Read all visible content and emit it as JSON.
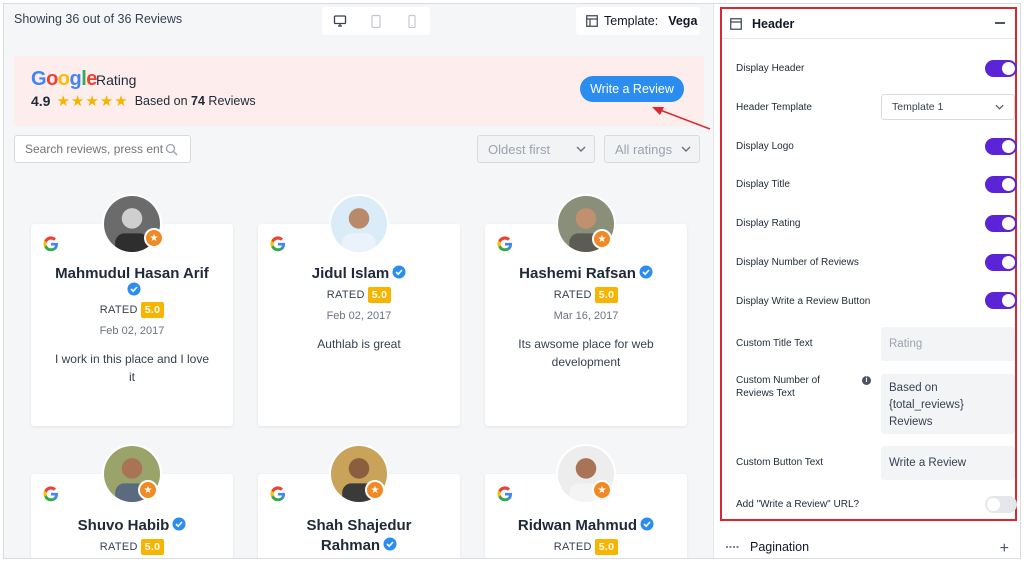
{
  "preview": {
    "showing_text": "Showing 36 out of 36 Reviews",
    "template_label": "Template:",
    "template_value": "Vega",
    "header": {
      "logo_letters": [
        "G",
        "o",
        "o",
        "g",
        "l",
        "e"
      ],
      "title": "Rating",
      "rating": "4.9",
      "stars": "★★★★★",
      "based_on_prefix": "Based on",
      "count": "74",
      "based_on_suffix": "Reviews",
      "button_label": "Write a Review"
    },
    "search_placeholder": "Search reviews, press ent",
    "sort_value": "Oldest first",
    "ratings_value": "All ratings",
    "rated_label": "RATED",
    "cards": [
      {
        "name": "Mahmudul Hasan Arif",
        "score": "5.0",
        "date": "Feb 02, 2017",
        "text": "I work in this place and I love it"
      },
      {
        "name": "Jidul Islam",
        "score": "5.0",
        "date": "Feb 02, 2017",
        "text": "Authlab is great"
      },
      {
        "name": "Hashemi Rafsan",
        "score": "5.0",
        "date": "Mar 16, 2017",
        "text": "Its awsome place for web development"
      },
      {
        "name": "Shuvo Habib",
        "score": "5.0",
        "date": "",
        "text": ""
      },
      {
        "name": "Shah Shajedur Rahman",
        "score": "5.0",
        "date": "",
        "text": ""
      },
      {
        "name": "Ridwan Mahmud",
        "score": "5.0",
        "date": "",
        "text": ""
      }
    ]
  },
  "settings": {
    "section_title": "Header",
    "rows": {
      "display_header": "Display Header",
      "header_template": "Header Template",
      "header_template_value": "Template 1",
      "display_logo": "Display Logo",
      "display_title": "Display Title",
      "display_rating": "Display Rating",
      "display_number": "Display Number of Reviews",
      "display_write": "Display Write a Review Button",
      "custom_title": "Custom Title Text",
      "custom_title_placeholder": "Rating",
      "custom_number_line1": "Custom Number of",
      "custom_number_line2": "Reviews Text",
      "custom_number_value_1": "Based on",
      "custom_number_value_2": "{total_reviews}",
      "custom_number_value_3": "Reviews",
      "custom_button": "Custom Button Text",
      "custom_button_value": "Write a Review",
      "add_url": "Add \"Write a Review\" URL?"
    },
    "pagination_title": "Pagination"
  },
  "colors": {
    "toggle_on": "#5b24d6",
    "button_blue": "#2b8df0",
    "score_badge": "#f7b500",
    "highlight_border": "#d9282f",
    "banner_bg": "#fdeeed"
  }
}
